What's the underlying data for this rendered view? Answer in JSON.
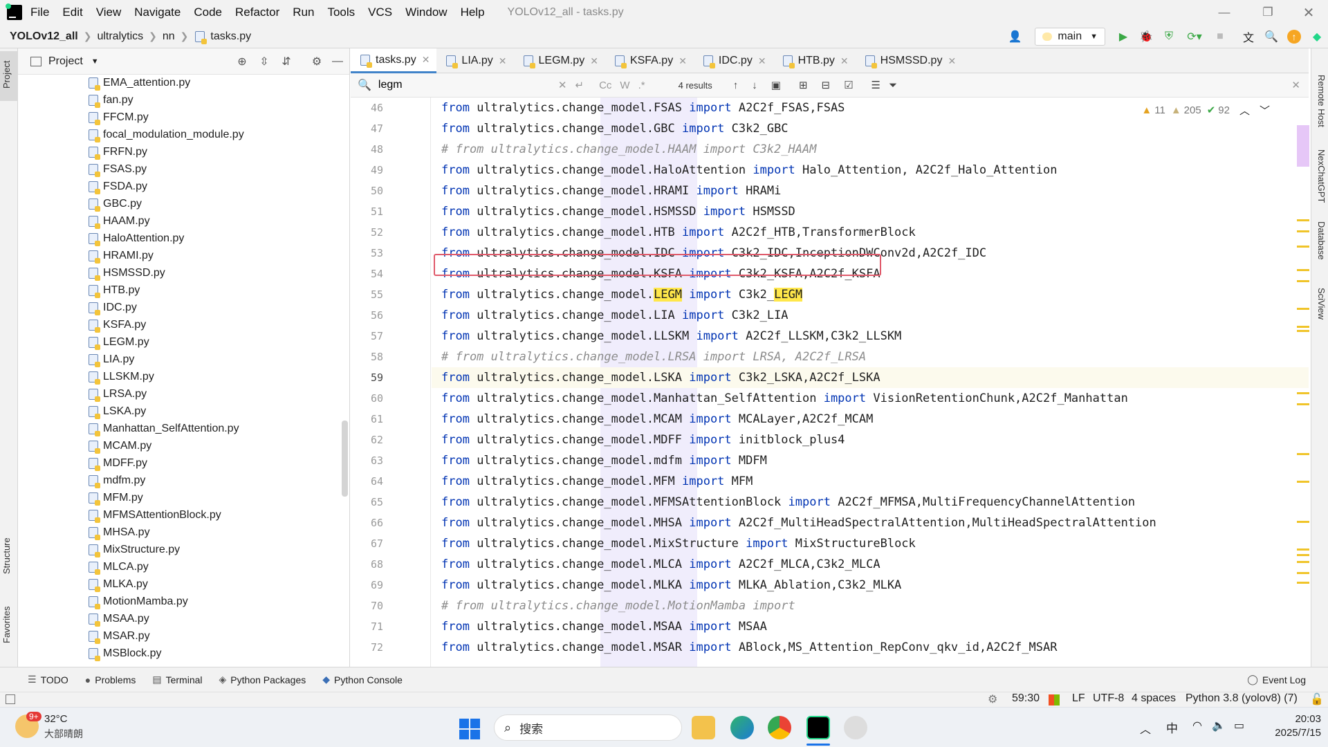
{
  "window": {
    "title": "YOLOv12_all - tasks.py",
    "menu": [
      "File",
      "Edit",
      "View",
      "Navigate",
      "Code",
      "Refactor",
      "Run",
      "Tools",
      "VCS",
      "Window",
      "Help"
    ]
  },
  "breadcrumb": [
    "YOLOv12_all",
    "ultralytics",
    "nn",
    "tasks.py"
  ],
  "toolbar": {
    "branch": "main"
  },
  "project_panel": {
    "title": "Project",
    "files": [
      "EMA_attention.py",
      "fan.py",
      "FFCM.py",
      "focal_modulation_module.py",
      "FRFN.py",
      "FSAS.py",
      "FSDA.py",
      "GBC.py",
      "HAAM.py",
      "HaloAttention.py",
      "HRAMI.py",
      "HSMSSD.py",
      "HTB.py",
      "IDC.py",
      "KSFA.py",
      "LEGM.py",
      "LIA.py",
      "LLSKM.py",
      "LRSA.py",
      "LSKA.py",
      "Manhattan_SelfAttention.py",
      "MCAM.py",
      "MDFF.py",
      "mdfm.py",
      "MFM.py",
      "MFMSAttentionBlock.py",
      "MHSA.py",
      "MixStructure.py",
      "MLCA.py",
      "MLKA.py",
      "MotionMamba.py",
      "MSAA.py",
      "MSAR.py",
      "MSBlock.py"
    ]
  },
  "tabs": [
    "tasks.py",
    "LIA.py",
    "LEGM.py",
    "KSFA.py",
    "IDC.py",
    "HTB.py",
    "HSMSSD.py"
  ],
  "find": {
    "query": "legm",
    "results": "4 results",
    "opts": [
      "Cc",
      "W",
      ".*"
    ]
  },
  "inspections": {
    "warnings": "11",
    "weak": "205",
    "ok": "92"
  },
  "code": {
    "lines": [
      {
        "n": "46",
        "pre": "from",
        "mid": " ultralytics.change_model.FSAS ",
        "kw2": "import",
        "post": " A2C2f_FSAS,FSAS",
        "comment": false
      },
      {
        "n": "47",
        "pre": "from",
        "mid": " ultralytics.change_model.GBC ",
        "kw2": "import",
        "post": " C3k2_GBC",
        "comment": false
      },
      {
        "n": "48",
        "text": "# from ultralytics.change_model.HAAM import C3k2_HAAM",
        "comment": true
      },
      {
        "n": "49",
        "pre": "from",
        "mid": " ultralytics.change_model.HaloAttention ",
        "kw2": "import",
        "post": " Halo_Attention, A2C2f_Halo_Attention",
        "comment": false
      },
      {
        "n": "50",
        "pre": "from",
        "mid": " ultralytics.change_model.HRAMI ",
        "kw2": "import",
        "post": " HRAMi",
        "comment": false
      },
      {
        "n": "51",
        "pre": "from",
        "mid": " ultralytics.change_model.HSMSSD ",
        "kw2": "import",
        "post": " HSMSSD",
        "comment": false
      },
      {
        "n": "52",
        "pre": "from",
        "mid": " ultralytics.change_model.HTB ",
        "kw2": "import",
        "post": " A2C2f_HTB,TransformerBlock",
        "comment": false
      },
      {
        "n": "53",
        "pre": "from",
        "mid": " ultralytics.change_model.IDC ",
        "kw2": "import",
        "post": " C3k2_IDC,InceptionDWConv2d,A2C2f_IDC",
        "comment": false
      },
      {
        "n": "54",
        "pre": "from",
        "mid": " ultralytics.change_model.KSFA ",
        "kw2": "import",
        "post": " C3k2_KSFA,A2C2f_KSFA",
        "comment": false
      },
      {
        "n": "55",
        "legm": true
      },
      {
        "n": "56",
        "pre": "from",
        "mid": " ultralytics.change_model.LIA ",
        "kw2": "import",
        "post": " C3k2_LIA",
        "comment": false
      },
      {
        "n": "57",
        "pre": "from",
        "mid": " ultralytics.change_model.LLSKM ",
        "kw2": "import",
        "post": " A2C2f_LLSKM,C3k2_LLSKM",
        "comment": false
      },
      {
        "n": "58",
        "text": "# from ultralytics.change_model.LRSA import LRSA, A2C2f_LRSA",
        "comment": true
      },
      {
        "n": "59",
        "pre": "from",
        "mid": " ultralytics.change_model.LSKA ",
        "kw2": "import",
        "post": " C3k2_LSKA,A2C2f_LSKA",
        "comment": false,
        "current": true
      },
      {
        "n": "60",
        "pre": "from",
        "mid": " ultralytics.change_model.Manhattan_SelfAttention ",
        "kw2": "import",
        "post": " VisionRetentionChunk,A2C2f_Manhattan",
        "comment": false
      },
      {
        "n": "61",
        "pre": "from",
        "mid": " ultralytics.change_model.MCAM ",
        "kw2": "import",
        "post": " MCALayer,A2C2f_MCAM",
        "comment": false
      },
      {
        "n": "62",
        "pre": "from",
        "mid": " ultralytics.change_model.MDFF ",
        "kw2": "import",
        "post": " initblock_plus4",
        "comment": false
      },
      {
        "n": "63",
        "pre": "from",
        "mid": " ultralytics.change_model.mdfm ",
        "kw2": "import",
        "post": " MDFM",
        "comment": false
      },
      {
        "n": "64",
        "pre": "from",
        "mid": " ultralytics.change_model.MFM ",
        "kw2": "import",
        "post": " MFM",
        "comment": false
      },
      {
        "n": "65",
        "pre": "from",
        "mid": " ultralytics.change_model.MFMSAttentionBlock ",
        "kw2": "import",
        "post": " A2C2f_MFMSA,MultiFrequencyChannelAttention",
        "comment": false
      },
      {
        "n": "66",
        "pre": "from",
        "mid": " ultralytics.change_model.MHSA ",
        "kw2": "import",
        "post": " A2C2f_MultiHeadSpectralAttention,MultiHeadSpectralAttention",
        "comment": false
      },
      {
        "n": "67",
        "pre": "from",
        "mid": " ultralytics.change_model.MixStructure ",
        "kw2": "import",
        "post": " MixStructureBlock",
        "comment": false
      },
      {
        "n": "68",
        "pre": "from",
        "mid": " ultralytics.change_model.MLCA ",
        "kw2": "import",
        "post": " A2C2f_MLCA,C3k2_MLCA",
        "comment": false
      },
      {
        "n": "69",
        "pre": "from",
        "mid": " ultralytics.change_model.MLKA ",
        "kw2": "import",
        "post": " MLKA_Ablation,C3k2_MLKA",
        "comment": false
      },
      {
        "n": "70",
        "text": "# from ultralytics.change_model.MotionMamba import",
        "comment": true
      },
      {
        "n": "71",
        "pre": "from",
        "mid": " ultralytics.change_model.MSAA ",
        "kw2": "import",
        "post": " MSAA",
        "comment": false
      },
      {
        "n": "72",
        "pre": "from",
        "mid": " ultralytics.change_model.MSAR ",
        "kw2": "import",
        "post": " ABlock,MS_Attention_RepConv_qkv_id,A2C2f_MSAR",
        "comment": false
      }
    ],
    "legm_line": {
      "a": "from",
      " b": " ultralytics.change_model.",
      "c": "LEGM",
      "d": " ",
      "e": "import",
      "f": " C3k2_",
      "g": "LEGM"
    }
  },
  "right_tools": [
    "Remote Host",
    "NexChatGPT",
    "Database",
    "SciView"
  ],
  "left_tools": [
    "Project",
    "Structure",
    "Favorites"
  ],
  "bottom_tools": [
    "TODO",
    "Problems",
    "Terminal",
    "Python Packages",
    "Python Console",
    "Event Log"
  ],
  "status": {
    "position": "59:30",
    "line_sep": "LF",
    "encoding": "UTF-8",
    "indent": "4 spaces",
    "interpreter": "Python 3.8 (yolov8) (7)"
  },
  "taskbar": {
    "temp": "32°C",
    "weather": "大部晴朗",
    "badge": "9+",
    "search": "搜索",
    "ime": "中",
    "time": "20:03",
    "date": "2025/7/15"
  }
}
